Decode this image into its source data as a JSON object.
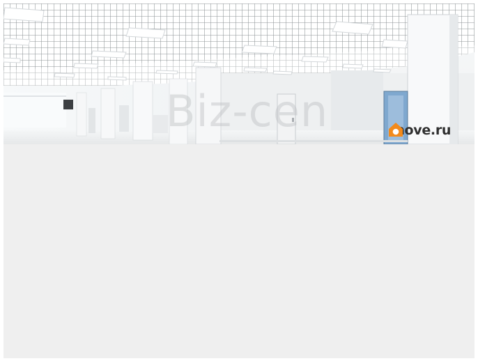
{
  "photo": {
    "subject": "office-interior-photo",
    "watermark_text": "Biz-cen",
    "brand": {
      "text": "move.ru",
      "icon": "house-icon",
      "icon_color": "#f28a1c"
    }
  },
  "colors": {
    "page_background": "#efefef",
    "frame_border": "#ffffff"
  }
}
